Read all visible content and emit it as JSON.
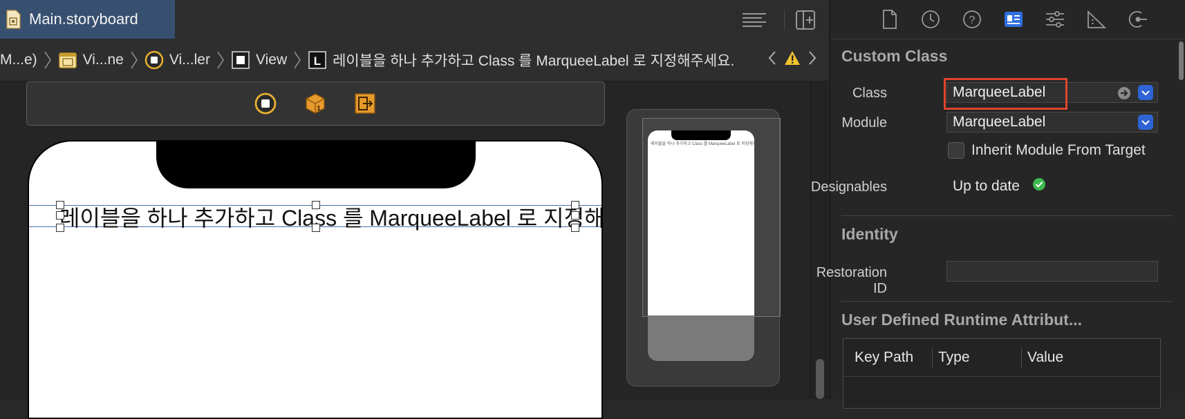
{
  "tab": {
    "title": "Main.storyboard"
  },
  "breadcrumb": {
    "items": [
      "M...e)",
      "Vi...ne",
      "Vi...ler",
      "View",
      "레이블을 하나 추가하고 Class 를 MarqueeLabel 로 지정해주세요."
    ],
    "icons": [
      "storyboard-scene-icon",
      "viewcontroller-icon",
      "view-icon",
      "label-icon"
    ]
  },
  "canvas": {
    "label_text": "레이블을 하나 추가하고 Class 를 MarqueeLabel 로 지정해주세요.",
    "minimap_text": "레이블을 하나 추가하고 Class 를 MarqueeLabel 로 지정해주세요."
  },
  "inspector": {
    "custom_class": {
      "title": "Custom Class",
      "class_label": "Class",
      "class_value": "MarqueeLabel",
      "module_label": "Module",
      "module_value": "MarqueeLabel",
      "inherit_label": "Inherit Module From Target",
      "inherit_checked": false,
      "designables_label": "Designables",
      "designables_value": "Up to date"
    },
    "identity": {
      "title": "Identity",
      "restoration_label": "Restoration ID",
      "restoration_value": ""
    },
    "runtime_attributes": {
      "title": "User Defined Runtime Attribut...",
      "columns": [
        "Key Path",
        "Type",
        "Value"
      ]
    }
  },
  "colors": {
    "accent_blue": "#2f64d6",
    "highlight_red": "#e0452d",
    "status_green": "#3fb950",
    "warning_yellow": "#f2c230",
    "tab_active": "#385070"
  }
}
